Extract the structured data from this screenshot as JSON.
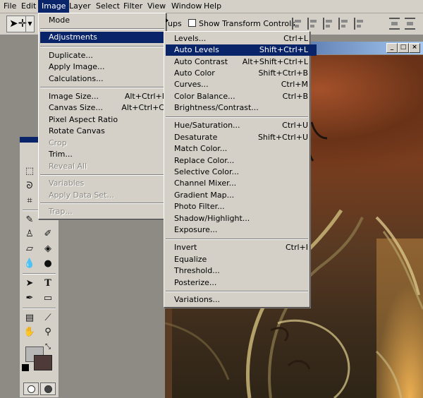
{
  "menubar": {
    "items": [
      "File",
      "Edit",
      "Image",
      "Layer",
      "Select",
      "Filter",
      "View",
      "Window",
      "Help"
    ],
    "active": "Image"
  },
  "options_bar": {
    "groups_label": "ups",
    "show_transform_label": "Show Transform Controls"
  },
  "image_menu": {
    "items": [
      {
        "label": "Mode",
        "submenu": true
      },
      {
        "label": "Adjustments",
        "submenu": true,
        "highlighted": true
      },
      {
        "label": "Duplicate..."
      },
      {
        "label": "Apply Image..."
      },
      {
        "label": "Calculations..."
      },
      {
        "label": "Image Size...",
        "shortcut": "Alt+Ctrl+I"
      },
      {
        "label": "Canvas Size...",
        "shortcut": "Alt+Ctrl+C"
      },
      {
        "label": "Pixel Aspect Ratio",
        "submenu": true
      },
      {
        "label": "Rotate Canvas",
        "submenu": true
      },
      {
        "label": "Crop",
        "disabled": true
      },
      {
        "label": "Trim..."
      },
      {
        "label": "Reveal All",
        "disabled": true
      },
      {
        "label": "Variables",
        "submenu": true,
        "disabled": true
      },
      {
        "label": "Apply Data Set...",
        "disabled": true
      },
      {
        "label": "Trap...",
        "disabled": true
      }
    ]
  },
  "adjustments_menu": {
    "items": [
      {
        "label": "Levels...",
        "shortcut": "Ctrl+L"
      },
      {
        "label": "Auto Levels",
        "shortcut": "Shift+Ctrl+L",
        "highlighted": true
      },
      {
        "label": "Auto Contrast",
        "shortcut": "Alt+Shift+Ctrl+L"
      },
      {
        "label": "Auto Color",
        "shortcut": "Shift+Ctrl+B"
      },
      {
        "label": "Curves...",
        "shortcut": "Ctrl+M"
      },
      {
        "label": "Color Balance...",
        "shortcut": "Ctrl+B"
      },
      {
        "label": "Brightness/Contrast..."
      },
      {
        "label": "Hue/Saturation...",
        "shortcut": "Ctrl+U"
      },
      {
        "label": "Desaturate",
        "shortcut": "Shift+Ctrl+U"
      },
      {
        "label": "Match Color..."
      },
      {
        "label": "Replace Color..."
      },
      {
        "label": "Selective Color..."
      },
      {
        "label": "Channel Mixer..."
      },
      {
        "label": "Gradient Map..."
      },
      {
        "label": "Photo Filter..."
      },
      {
        "label": "Shadow/Highlight..."
      },
      {
        "label": "Exposure..."
      },
      {
        "label": "Invert",
        "shortcut": "Ctrl+I"
      },
      {
        "label": "Equalize"
      },
      {
        "label": "Threshold..."
      },
      {
        "label": "Posterize..."
      },
      {
        "label": "Variations..."
      }
    ]
  },
  "window_controls": [
    "_",
    "□",
    "×"
  ],
  "colors": {
    "highlight": "#0a246a",
    "menu_bg": "#d4d0c8",
    "foreground_swatch": "#b7b7b7",
    "background_swatch": "#4e3a37"
  }
}
